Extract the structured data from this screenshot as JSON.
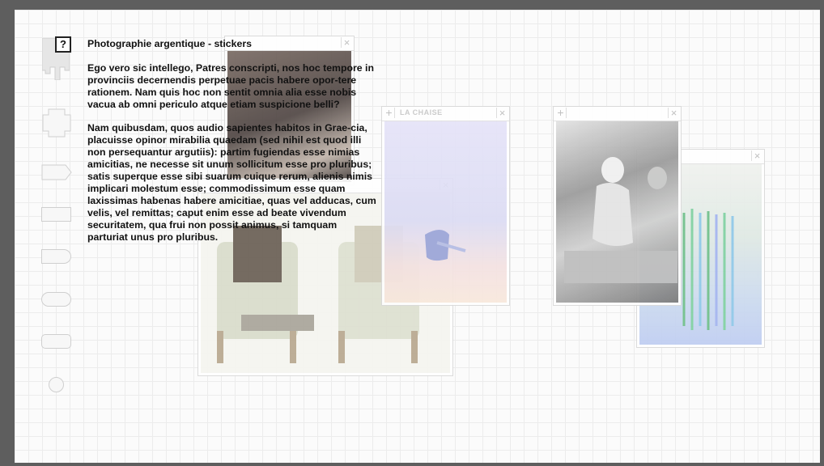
{
  "help": {
    "label": "?"
  },
  "toolbar": {
    "shapes": [
      "stamp-shape",
      "cross-shape",
      "tag-right-shape",
      "rectangle-shape",
      "rounded-tab-shape",
      "pill-shape",
      "rounded-rectangle-shape",
      "circle-shape"
    ]
  },
  "article": {
    "title": "Photographie argentique - stickers",
    "paragraph1": "Ego vero sic intellego, Patres conscripti, nos hoc tempore in provinciis decernendis perpetuae pacis habere opor-tere rationem. Nam quis hoc non sentit omnia alia esse nobis vacua ab omni periculo atque etiam suspicione belli?",
    "paragraph2": "Nam quibusdam, quos audio sapientes habitos in Grae-cia, placuisse opinor mirabilia quaedam (sed nihil est quod illi non persequantur argutiis): partim fugiendas esse nimias amicitias, ne necesse sit unum sollicitum esse pro pluribus; satis superque esse sibi suarum cuique rerum, alienis nimis implicari molestum esse; commodissimum esse quam laxissimas habenas habere amicitiae, quas vel adducas, cum velis, vel remittas; caput enim esse ad beate vivendum securitatem, qua frui non possit animus, si tamquam parturiat unus pro pluribus."
  },
  "stickers": [
    {
      "name": "dark-photo",
      "title": "",
      "close": "×"
    },
    {
      "name": "armchairs",
      "title": "",
      "close": "×"
    },
    {
      "name": "la-chaise",
      "title": "LA CHAISE",
      "plus": "+",
      "close": "×"
    },
    {
      "name": "bw-figures",
      "title": "",
      "plus": "+",
      "close": "×"
    },
    {
      "name": "colored-sculpture",
      "title": "",
      "close": "×"
    }
  ],
  "colors": {
    "background": "#5e5e5e",
    "canvas": "#fbfbfb",
    "grid": "#ececec",
    "text": "#111111"
  }
}
